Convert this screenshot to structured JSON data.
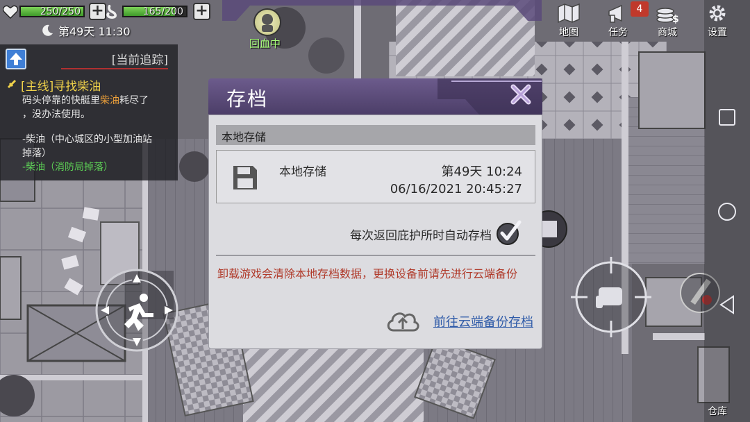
{
  "hud": {
    "health": {
      "value": 250,
      "max": 250,
      "text": "250/250",
      "icon": "heart-icon"
    },
    "hunger": {
      "value": 165,
      "max": 200,
      "text": "165/200",
      "icon": "stomach-icon"
    },
    "time": "第49天 11:30",
    "status_label": "回血中"
  },
  "menu": {
    "map": "地图",
    "tasks": "任务",
    "tasks_badge": "4",
    "shop": "商城",
    "settings": "设置",
    "storage": "仓库"
  },
  "quest": {
    "header": "[当前追踪]",
    "title": "[主线]寻找柴油",
    "line1_a": "码头停靠的快艇里",
    "line1_hl": "柴油",
    "line1_b": "耗尽了",
    "line2": "，没办法使用。",
    "line3": "-柴油（中心城区的小型加油站",
    "line4": "掉落）",
    "line5": "-柴油（消防局掉落）"
  },
  "dialog": {
    "title": "存档",
    "section": "本地存储",
    "save_name": "本地存储",
    "save_day": "第49天 10:24",
    "save_date": "06/16/2021 20:45:27",
    "autosave_label": "每次返回庇护所时自动存档",
    "autosave_checked": true,
    "warning": "卸载游戏会清除本地存档数据，更换设备前请先进行云端备份",
    "cloud_link": "前往云端备份存档"
  },
  "colors": {
    "accent_purple": "#5a4a7a",
    "health_green": "#5cbf3a",
    "warning_red": "#b03a2a",
    "link_blue": "#2e5aa8",
    "badge_red": "#c0392b"
  }
}
